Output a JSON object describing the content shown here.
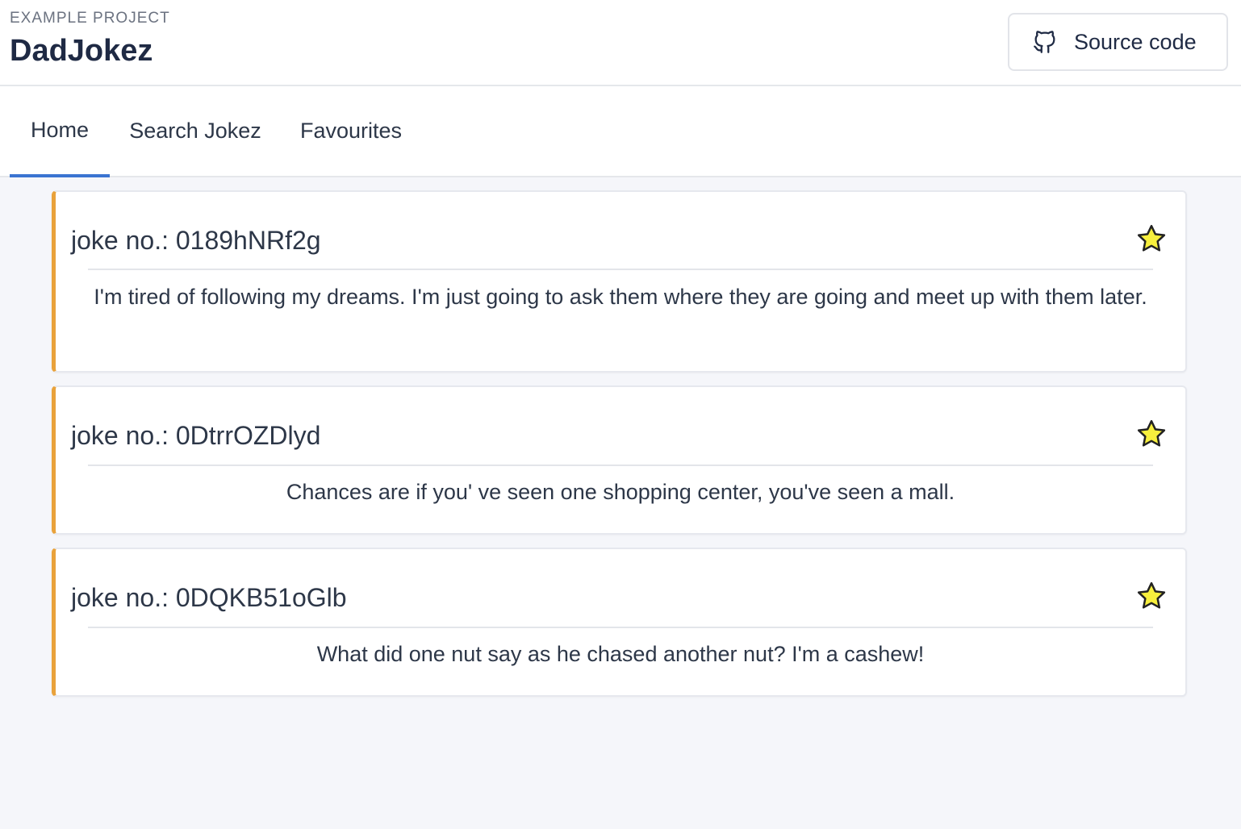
{
  "header": {
    "eyebrow": "EXAMPLE PROJECT",
    "title": "DadJokez",
    "source_button": {
      "label": "Source code",
      "icon": "github-icon"
    }
  },
  "tabs": [
    {
      "label": "Home",
      "active": true
    },
    {
      "label": "Search Jokez",
      "active": false
    },
    {
      "label": "Favourites",
      "active": false
    }
  ],
  "jokes": [
    {
      "title": "joke no.: 0189hNRf2g",
      "text": "I'm tired of following my dreams. I'm just going to ask them where they are going and meet up with them later.",
      "icon": "star-icon"
    },
    {
      "title": "joke no.: 0DtrrOZDlyd",
      "text": "Chances are if you' ve seen one shopping center, you've seen a mall.",
      "icon": "star-icon"
    },
    {
      "title": "joke no.: 0DQKB51oGlb",
      "text": "What did one nut say as he chased another nut? I'm a cashew!",
      "icon": "star-icon"
    }
  ],
  "colors": {
    "accent": "#3b74d1",
    "card_border": "#e9a23b",
    "star_fill": "#f7ef3d",
    "background": "#f5f6fa"
  }
}
